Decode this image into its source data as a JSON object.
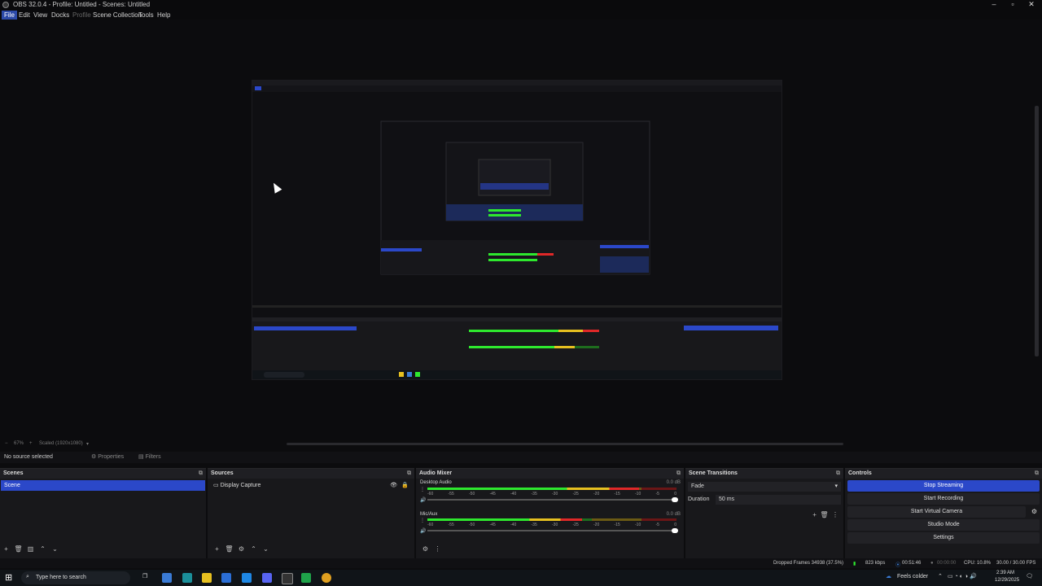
{
  "window": {
    "title": "OBS 32.0.4 - Profile: Untitled - Scenes: Untitled"
  },
  "menu": [
    {
      "label": "File",
      "active": true
    },
    {
      "label": "Edit"
    },
    {
      "label": "View"
    },
    {
      "label": "Docks"
    },
    {
      "label": "Profile",
      "disabled": true
    },
    {
      "label": "Scene Collection"
    },
    {
      "label": "Tools"
    },
    {
      "label": "Help"
    }
  ],
  "preview": {
    "zoom_label": "67%",
    "scale_label": "Scaled (1920x1080)"
  },
  "source_bar": {
    "status": "No source selected",
    "properties": "Properties",
    "filters": "Filters"
  },
  "docks": {
    "scenes": {
      "title": "Scenes",
      "items": [
        "Scene"
      ]
    },
    "sources": {
      "title": "Sources",
      "items": [
        "Display Capture"
      ]
    },
    "mixer": {
      "title": "Audio Mixer",
      "channels": [
        {
          "name": "Desktop Audio",
          "db": "0.0 dB",
          "level": 0.85
        },
        {
          "name": "Mic/Aux",
          "db": "0.0 dB",
          "level": 0.62
        }
      ],
      "ticks": [
        "-60",
        "-55",
        "-50",
        "-45",
        "-40",
        "-35",
        "-30",
        "-25",
        "-20",
        "-15",
        "-10",
        "-5",
        "0"
      ]
    },
    "transitions": {
      "title": "Scene Transitions",
      "type": "Fade",
      "duration_label": "Duration",
      "duration": "50 ms"
    },
    "controls": {
      "title": "Controls",
      "buttons": [
        "Stop Streaming",
        "Start Recording",
        "Start Virtual Camera",
        "Studio Mode",
        "Settings"
      ]
    }
  },
  "status": {
    "dropped": "Dropped Frames 34938 (37.5%)",
    "bitrate": "823 kbps",
    "stream_time": "00:51:46",
    "rec_time": "00:00:00",
    "cpu": "CPU: 10.8%",
    "fps": "30.00 / 30.00 FPS"
  },
  "taskbar": {
    "search_placeholder": "Type here to search",
    "weather": "Feels colder",
    "time": "2:39 AM",
    "date": "12/29/2025"
  },
  "colors": {
    "accent": "#2b48c9",
    "bg": "#0c0c0e",
    "panel": "#18181b"
  }
}
